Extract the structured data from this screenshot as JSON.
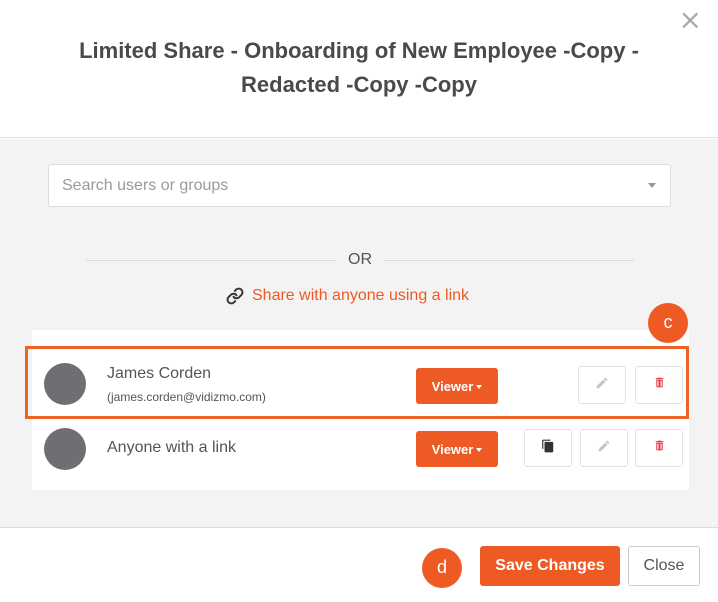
{
  "dialog": {
    "title": "Limited Share - Onboarding of New Employee -Copy - Redacted -Copy -Copy",
    "close_icon": "close-icon"
  },
  "search": {
    "placeholder": "Search users or groups",
    "value": ""
  },
  "separator": {
    "or_label": "OR"
  },
  "share_link": {
    "icon": "link-icon",
    "label": "Share with anyone using a link"
  },
  "annotations": {
    "badge_c": "c",
    "badge_d": "d",
    "highlight_color": "#ec6424"
  },
  "shares": [
    {
      "name": "James Corden",
      "email": "(james.corden@vidizmo.com)",
      "role": "Viewer",
      "actions": [
        "edit-icon",
        "delete-icon"
      ]
    },
    {
      "name": "Anyone with a link",
      "role": "Viewer",
      "actions": [
        "copy-icon",
        "edit-icon",
        "delete-icon"
      ]
    }
  ],
  "footer": {
    "save_label": "Save Changes",
    "close_label": "Close"
  },
  "colors": {
    "accent": "#ee5a24",
    "delete_icon": "#e0454f",
    "panel_background": "#f3f3f3",
    "avatar": "#6e6f72"
  }
}
